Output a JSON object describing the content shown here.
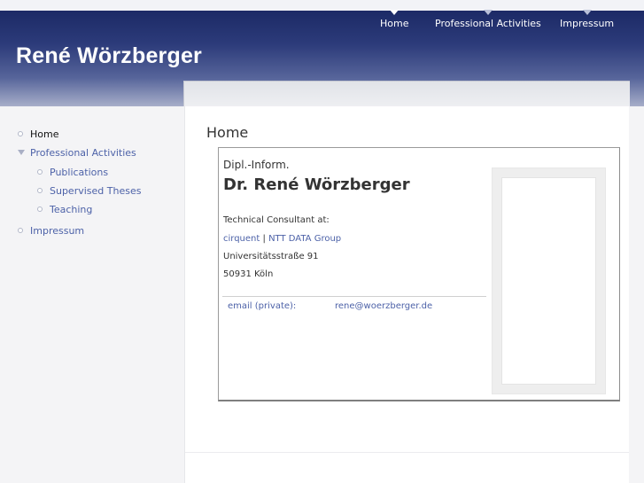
{
  "site": {
    "title": "René Wörzberger"
  },
  "topnav": {
    "items": [
      "Home",
      "Professional Activities",
      "Impressum"
    ]
  },
  "sidebar": {
    "items": [
      {
        "label": "Home"
      },
      {
        "label": "Professional Activities"
      },
      {
        "label": "Publications"
      },
      {
        "label": "Supervised Theses"
      },
      {
        "label": "Teaching"
      },
      {
        "label": "Impressum"
      }
    ]
  },
  "main": {
    "heading": "Home",
    "card": {
      "degree": "Dipl.-Inform.",
      "name": "Dr. René Wörzberger",
      "role": "Technical Consultant at:",
      "company1": "cirquent",
      "separator": "|",
      "company2": "NTT DATA Group",
      "street": "Universitätsstraße 91",
      "city": "50931 Köln",
      "email_label": "email (private):",
      "email": "rene@woerzberger.de"
    }
  },
  "colors": {
    "header_dark": "#1c2a66",
    "link": "#4d62a8",
    "text": "#333333"
  }
}
